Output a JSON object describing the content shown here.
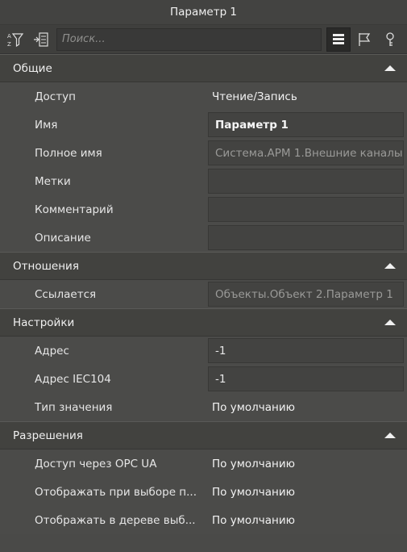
{
  "window": {
    "title": "Параметр 1"
  },
  "toolbar": {
    "search_placeholder": "Поиск...",
    "icons": [
      "sort-az-filter-icon",
      "collapse-tree-icon",
      "list-view-icon",
      "flag-icon",
      "key-icon"
    ]
  },
  "sections": [
    {
      "title": "Общие",
      "rows": [
        {
          "label": "Доступ",
          "value": "Чтение/Запись"
        },
        {
          "label": "Имя",
          "value": "Параметр 1"
        },
        {
          "label": "Полное имя",
          "value": "Система.АРМ 1.Внешние каналы."
        },
        {
          "label": "Метки",
          "value": ""
        },
        {
          "label": "Комментарий",
          "value": ""
        },
        {
          "label": "Описание",
          "value": ""
        }
      ]
    },
    {
      "title": "Отношения",
      "rows": [
        {
          "label": "Ссылается",
          "value": "Объекты.Объект 2.Параметр 1"
        }
      ]
    },
    {
      "title": "Настройки",
      "rows": [
        {
          "label": "Адрес",
          "value": "-1"
        },
        {
          "label": "Адрес IEC104",
          "value": "-1"
        },
        {
          "label": "Тип значения",
          "value": "По умолчанию"
        }
      ]
    },
    {
      "title": "Разрешения",
      "rows": [
        {
          "label": "Доступ через OPC UA",
          "value": "По умолчанию"
        },
        {
          "label": "Отображать при выборе п...",
          "value": "По умолчанию"
        },
        {
          "label": "Отображать в дереве выб...",
          "value": "По умолчанию"
        }
      ]
    }
  ]
}
